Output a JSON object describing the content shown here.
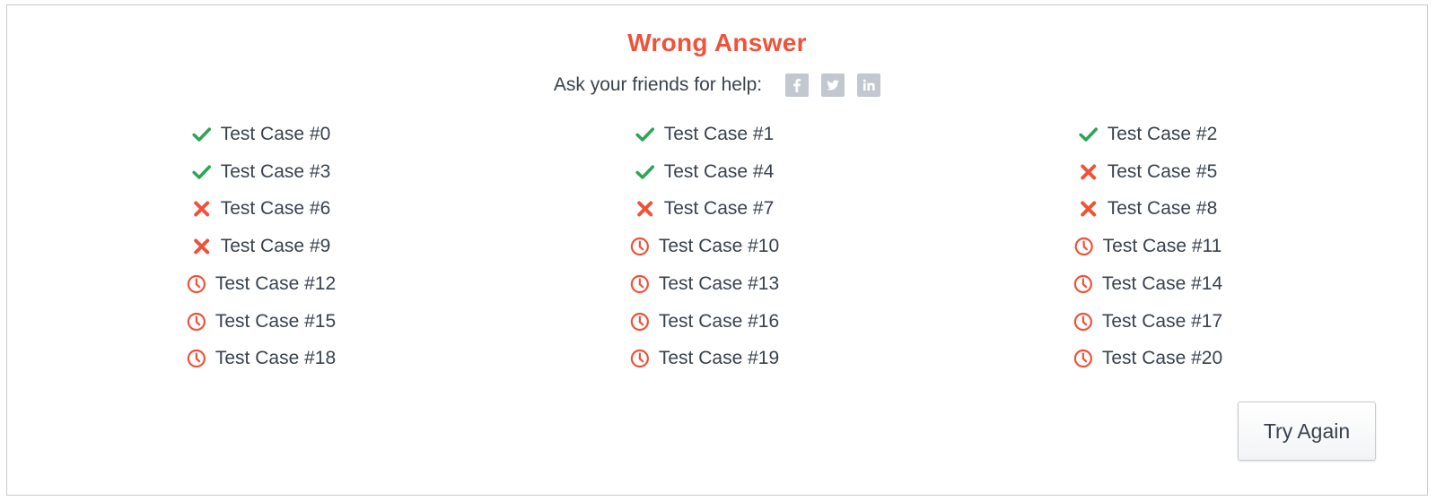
{
  "result": {
    "title": "Wrong Answer",
    "title_color": "#f05239"
  },
  "share": {
    "label": "Ask your friends for help:",
    "networks": [
      "facebook",
      "twitter",
      "linkedin"
    ]
  },
  "colors": {
    "pass": "#2ea556",
    "fail": "#f05239",
    "timeout": "#f05239"
  },
  "test_cases": [
    {
      "label": "Test Case #0",
      "status": "pass"
    },
    {
      "label": "Test Case #1",
      "status": "pass"
    },
    {
      "label": "Test Case #2",
      "status": "pass"
    },
    {
      "label": "Test Case #3",
      "status": "pass"
    },
    {
      "label": "Test Case #4",
      "status": "pass"
    },
    {
      "label": "Test Case #5",
      "status": "fail"
    },
    {
      "label": "Test Case #6",
      "status": "fail"
    },
    {
      "label": "Test Case #7",
      "status": "fail"
    },
    {
      "label": "Test Case #8",
      "status": "fail"
    },
    {
      "label": "Test Case #9",
      "status": "fail"
    },
    {
      "label": "Test Case #10",
      "status": "timeout"
    },
    {
      "label": "Test Case #11",
      "status": "timeout"
    },
    {
      "label": "Test Case #12",
      "status": "timeout"
    },
    {
      "label": "Test Case #13",
      "status": "timeout"
    },
    {
      "label": "Test Case #14",
      "status": "timeout"
    },
    {
      "label": "Test Case #15",
      "status": "timeout"
    },
    {
      "label": "Test Case #16",
      "status": "timeout"
    },
    {
      "label": "Test Case #17",
      "status": "timeout"
    },
    {
      "label": "Test Case #18",
      "status": "timeout"
    },
    {
      "label": "Test Case #19",
      "status": "timeout"
    },
    {
      "label": "Test Case #20",
      "status": "timeout"
    }
  ],
  "actions": {
    "try_again_label": "Try Again"
  }
}
